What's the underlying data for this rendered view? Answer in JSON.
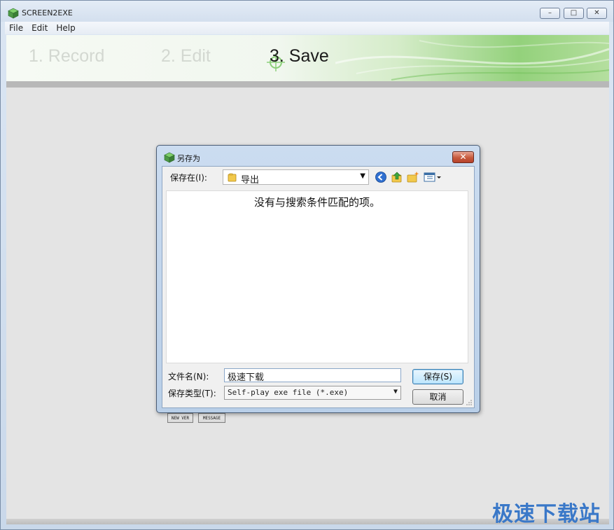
{
  "app": {
    "title": "SCREEN2EXE",
    "menu": [
      "File",
      "Edit",
      "Help"
    ],
    "window_buttons": {
      "minimize": "–",
      "maximize": "□",
      "close": "✕"
    }
  },
  "steps": [
    {
      "label": "1. Record",
      "active": false
    },
    {
      "label": "2. Edit",
      "active": false
    },
    {
      "label": "3. Save",
      "active": true
    }
  ],
  "background_buttons": [
    "NEW VER",
    "MESSAGE"
  ],
  "dialog": {
    "title": "另存为",
    "close": "✕",
    "look_in_label": "保存在(I):",
    "look_in_value": "导出",
    "empty_message": "没有与搜索条件匹配的项。",
    "filename_label": "文件名(N):",
    "filename_value": "极速下载",
    "filetype_label": "保存类型(T):",
    "filetype_value": "Self-play exe file (*.exe)",
    "save_button": "保存(S)",
    "cancel_button": "取消"
  },
  "watermark": "极速下载站",
  "colors": {
    "accent_blue": "#3a78c8",
    "banner_green": "#93d17b",
    "dialog_frame": "#b9cfe8"
  }
}
